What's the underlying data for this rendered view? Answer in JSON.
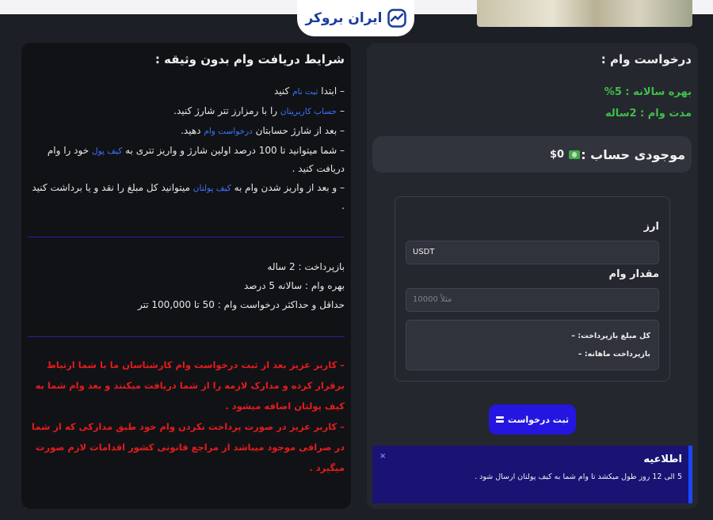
{
  "header": {
    "logo_text": "ایران بروکر"
  },
  "conditions": {
    "title": "شرایط دریافت وام بدون وثیقه :",
    "steps": [
      {
        "prefix": "– ابتدا ",
        "link": "ثبت نام",
        "suffix": " کنید"
      },
      {
        "prefix": "– ",
        "link": "حساب کاربریتان",
        "suffix": " را با رمزارز تتر شارژ کنید."
      },
      {
        "prefix": "– بعد از شارژ حسابتان ",
        "link": "درخواست وام",
        "suffix": " دهید."
      },
      {
        "prefix": "– شما میتوانید تا 100 درصد اولین شارژ و واریز تتری به ",
        "link": "کیف پول",
        "suffix": " خود را وام دریافت کنید ."
      },
      {
        "prefix": "– و بعد از واریز شدن وام به ",
        "link": "کیف پولتان",
        "suffix": " میتوانید کل مبلغ را نقد و یا برداشت کنید ."
      }
    ],
    "repayment": "بازپرداخت : 2 ساله",
    "interest": "بهره وام : سالانه 5 درصد",
    "min_max": "حداقل و حداکثر درخواست وام : 50 تا 100,000 تتر",
    "warning_1": "– کاربر عزیز بعد از ثبت درخواست وام کارشناسان ما با شما ارتباط برقرار کرده و مدارک لازمه را از شما دریافت میکنند و بعد وام شما به کیف پولتان اضافه میشود .",
    "warning_2": "– کاربر عزیز در صورت پرداخت نکردن وام خود طبق مدارکی که از شما در صرافی موجود میباشد از مراجع قانونی کشور اقدامات لازم صورت میگیرد ."
  },
  "loan_request": {
    "title": "درخواست وام :",
    "annual_rate": "بهره سالانه : 5%",
    "term": "مدت وام : 2ساله",
    "balance_label": "موجودی حساب :",
    "balance_value": "$0",
    "currency_label": "ارز",
    "currency_value": "USDT",
    "amount_label": "مقدار وام",
    "amount_placeholder": "مثلاً 10000",
    "total_repayment": "کل مبلغ بازپرداخت: –",
    "monthly_repayment": "بازپرداخت ماهانه: –",
    "submit_label": "ثبت درخواست"
  },
  "notice": {
    "title": "اطلاعیه",
    "text": "5 الی 12 روز طول میکشد تا وام شما به کیف پولتان ارسال شود .",
    "close": "×"
  },
  "colors": {
    "accent_green": "#3fbf49",
    "link_blue": "#3d73ff",
    "warning_red": "#e51c1c",
    "button_blue": "#2416e0"
  }
}
